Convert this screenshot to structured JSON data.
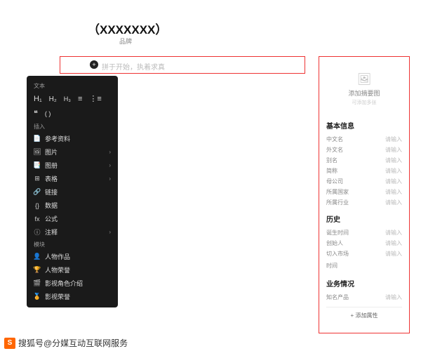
{
  "header": {
    "title": "（XXXXXXX）",
    "subtitle": "品牌"
  },
  "main": {
    "placeholder": "拼于开始，执着求真"
  },
  "toolbar": {
    "text_section": "文本",
    "h1": "H₁",
    "h2": "H₂",
    "h3": "H₃",
    "list_ul": "≡",
    "list_ol": "⋮≡",
    "quote": "❝",
    "bracket": "( )",
    "insert_section": "插入",
    "items": [
      {
        "icon": "📄",
        "label": "参考资料",
        "chev": ""
      },
      {
        "icon": "🖼",
        "label": "图片",
        "chev": "›"
      },
      {
        "icon": "📑",
        "label": "图册",
        "chev": "›"
      },
      {
        "icon": "⊞",
        "label": "表格",
        "chev": "›"
      },
      {
        "icon": "🔗",
        "label": "链接",
        "chev": ""
      },
      {
        "icon": "{}",
        "label": "数据",
        "chev": ""
      },
      {
        "icon": "fx",
        "label": "公式",
        "chev": ""
      },
      {
        "icon": "ⓘ",
        "label": "注释",
        "chev": "›"
      }
    ],
    "module_section": "模块",
    "modules": [
      {
        "icon": "👤",
        "label": "人物作品"
      },
      {
        "icon": "🏆",
        "label": "人物荣誉"
      },
      {
        "icon": "🎬",
        "label": "影视角色介绍"
      },
      {
        "icon": "🏅",
        "label": "影视荣誉"
      }
    ]
  },
  "sidebar": {
    "cover": {
      "add_text": "添加摘要图",
      "sub": "可添加多张"
    },
    "basic_section": "基本信息",
    "basic_fields": [
      {
        "label": "中文名",
        "value": "请输入"
      },
      {
        "label": "外文名",
        "value": "请输入"
      },
      {
        "label": "别名",
        "value": "请输入"
      },
      {
        "label": "简称",
        "value": "请输入"
      },
      {
        "label": "母公司",
        "value": "请输入"
      },
      {
        "label": "所属国家",
        "value": "请输入"
      },
      {
        "label": "所属行业",
        "value": "请输入"
      }
    ],
    "history_section": "历史",
    "history_fields": [
      {
        "label": "诞生时间",
        "value": "请输入"
      },
      {
        "label": "创始人",
        "value": "请输入"
      },
      {
        "label": "切入市场",
        "value": "请输入"
      }
    ],
    "history_extra": "时间",
    "business_section": "业务情况",
    "business_fields": [
      {
        "label": "知名产品",
        "value": "请输入"
      }
    ],
    "add_attr": "+ 添加属性"
  },
  "footer": {
    "logo": "S",
    "text": "搜狐号@分媒互动互联网服务"
  }
}
